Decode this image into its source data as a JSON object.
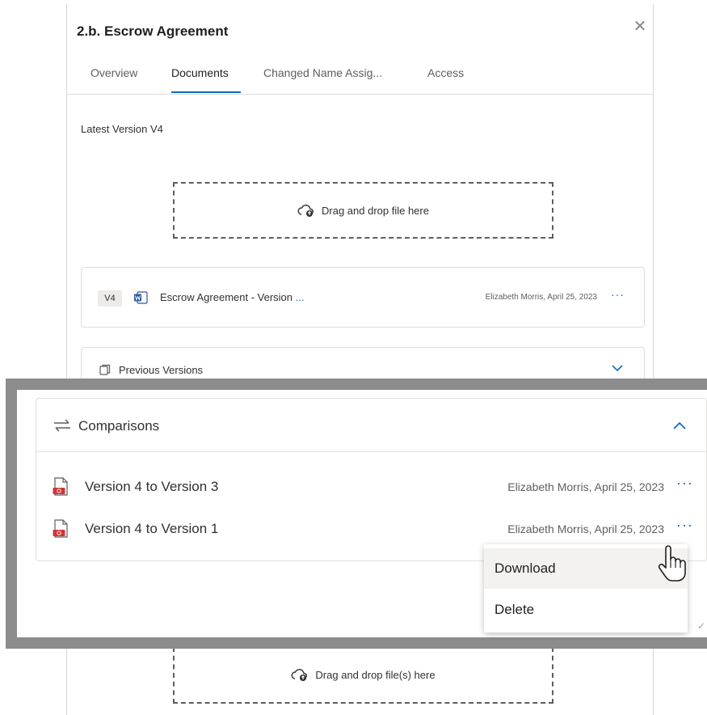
{
  "panel": {
    "title": "2.b. Escrow Agreement",
    "close_icon": "close-icon",
    "tabs": [
      {
        "label": "Overview",
        "active": false
      },
      {
        "label": "Documents",
        "active": true
      },
      {
        "label": "Changed Name Assig...",
        "active": false
      },
      {
        "label": "Access",
        "active": false
      }
    ],
    "latest_version_label": "Latest Version V4",
    "dropzone_top": "Drag and drop file here",
    "dropzone_bottom": "Drag and drop file(s) here",
    "latest_file": {
      "version": "V4",
      "name": "Escrow Agreement - Version ",
      "ellipsis": "...",
      "meta": "Elizabeth Morris, April 25, 2023",
      "more": "···"
    },
    "previous_versions_label": "Previous Versions"
  },
  "comparisons": {
    "title": "Comparisons",
    "rows": [
      {
        "label": "Version 4 to Version 3",
        "meta": "Elizabeth Morris, April 25, 2023",
        "more": "···"
      },
      {
        "label": "Version 4 to Version 1",
        "meta": "Elizabeth Morris, April 25, 2023",
        "more": "···"
      }
    ],
    "menu": {
      "items": [
        {
          "label": "Download",
          "hovered": true
        },
        {
          "label": "Delete",
          "hovered": false
        }
      ]
    }
  },
  "colors": {
    "accent": "#0f6cbd",
    "callout_border": "#8c8c8c",
    "pdf_red": "#d13438",
    "word_blue": "#2b579a"
  }
}
